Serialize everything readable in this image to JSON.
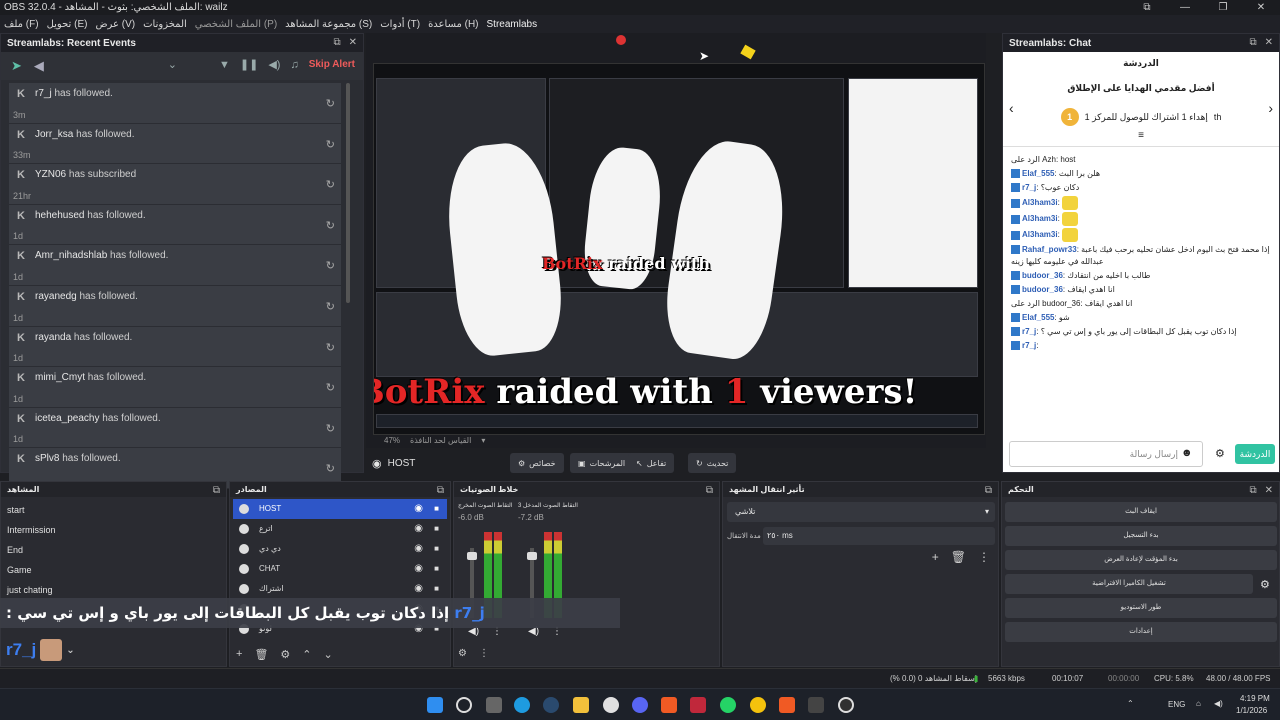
{
  "window": {
    "title": "OBS 32.0.4 - الملف الشخصي: بثوث - المشاهد: wailz",
    "controls": [
      "⧉",
      "—",
      "❐",
      "✕"
    ]
  },
  "menu": [
    "ملف (F)",
    "تحويل (E)",
    "عرض (V)",
    "المخزونات",
    "الملف الشخصي (P)",
    "مجموعة المشاهد (S)",
    "أدوات (T)",
    "مساعدة (H)",
    "Streamlabs"
  ],
  "events": {
    "title": "Streamlabs: Recent Events",
    "skip_alert": "Skip Alert",
    "items": [
      {
        "name": "r7_j",
        "action": "has followed.",
        "time": "3m"
      },
      {
        "name": "Jorr_ksa",
        "action": "has followed.",
        "time": "33m"
      },
      {
        "name": "YZN06",
        "action": "has subscribed",
        "time": "21hr"
      },
      {
        "name": "hehehused",
        "action": "has followed.",
        "time": "1d"
      },
      {
        "name": "Amr_nihadshlab",
        "action": "has followed.",
        "time": "1d"
      },
      {
        "name": "rayanedg",
        "action": "has followed.",
        "time": "1d"
      },
      {
        "name": "rayanda",
        "action": "has followed.",
        "time": "1d"
      },
      {
        "name": "mimi_Cmyt",
        "action": "has followed.",
        "time": "1d"
      },
      {
        "name": "icetea_peachy",
        "action": "has followed.",
        "time": "1d"
      },
      {
        "name": "sPlv8",
        "action": "has followed.",
        "time": ""
      }
    ]
  },
  "preview": {
    "raid_brand": "BotRix",
    "raid_text": "raided with",
    "raid_count": "1",
    "raid_suffix": "viewers!",
    "zoom": "47%",
    "fit_label": "القياس لحد النافذة"
  },
  "scenebar": {
    "current_source": "HOST",
    "properties": "خصائص",
    "filters": "المرشحات",
    "interact": "تفاعل",
    "refresh": "تحديث"
  },
  "chat": {
    "title": "Streamlabs: Chat",
    "tab": "الدردشة",
    "top_title": "أفضل مقدمي الهدايا على الإطلاق",
    "top_rank": "1",
    "top_desc": "إهداء 1 اشتراك للوصول للمركز 1",
    "top_user": "th",
    "messages": [
      {
        "user": "",
        "text": "الرد على Azh: host"
      },
      {
        "user": "Elaf_555",
        "text": "هلن برا البث"
      },
      {
        "user": "r7_j",
        "text": "دكان عوب؟"
      },
      {
        "user": "Al3ham3i",
        "text": ""
      },
      {
        "user": "Al3ham3i",
        "text": ""
      },
      {
        "user": "Al3ham3i",
        "text": ""
      },
      {
        "user": "Rahaf_powr33",
        "text": "إذا محمد فتح بث اليوم ادخل عشان تحليه برحب فيك باعبة عبدالله في عليومه كليها زينه"
      },
      {
        "user": "budoor_36",
        "text": "طالب با اخليه من انتقادك"
      },
      {
        "user": "budoor_36",
        "text": "انا اهدي ايقاف"
      },
      {
        "user": "",
        "text": "الرد على budoor_36: انا اهدي ايقاف"
      },
      {
        "user": "Elaf_555",
        "text": "شو"
      },
      {
        "user": "r7_j",
        "text": "إذا دكان توب يقبل كل البطاقات إلى يور باي و إس تي سي ؟"
      },
      {
        "user": "r7_j",
        "text": ""
      }
    ],
    "input_placeholder": "إرسال رسالة",
    "send_label": "الدردشة"
  },
  "scenes": {
    "title": "المشاهد",
    "items": [
      "start",
      "Intermission",
      "End",
      "Game",
      "just chating"
    ]
  },
  "sources": {
    "title": "المصادر",
    "items": [
      "HOST",
      "اترع",
      "دي دي",
      "CHAT",
      "اشتراك",
      "",
      "لوتو"
    ]
  },
  "mixer": {
    "title": "خلاط الصوتيات",
    "channels": [
      {
        "name": "التقاط الصوت المخرج",
        "db": "-6.0 dB"
      },
      {
        "name": "التقاط الصوت المدخل 3",
        "db": "-7.2 dB"
      }
    ]
  },
  "transitions": {
    "title": "تأثير انتقال المشهد",
    "type": "تلاشي",
    "duration_label": "مدة الانتقال",
    "duration": "٢٥٠ ms"
  },
  "controls": {
    "title": "التحكم",
    "buttons": [
      "ايقاف البث",
      "بدء التسجيل",
      "بدء المؤقت لإعادة العرض",
      "تشغيل الكاميرا الافتراضية",
      "طور الاستوديو",
      "إعدادات"
    ]
  },
  "subtitle": {
    "name": "r7_j",
    "text": "إذا دكان توب يقبل كل البطاقات إلى يور باي و إس تي سي :"
  },
  "bottom_user": "r7_j",
  "status": {
    "dropped": "إسقاط المشاهد 0 (0.0 %)",
    "bitrate": "5663 kbps",
    "stream_time": "00:10:07",
    "rec_time": "00:00:00",
    "cpu": "CPU: 5.8%",
    "fps": "48.00 / 48.00 FPS"
  },
  "taskbar": {
    "lang": "ENG",
    "time": "4:19 PM",
    "date": "1/1/2026"
  },
  "colors": {
    "accent": "#2e56c8",
    "streamlabs": "#31c3a2",
    "skip": "#ef5b5b",
    "raid_red": "#e32626"
  }
}
